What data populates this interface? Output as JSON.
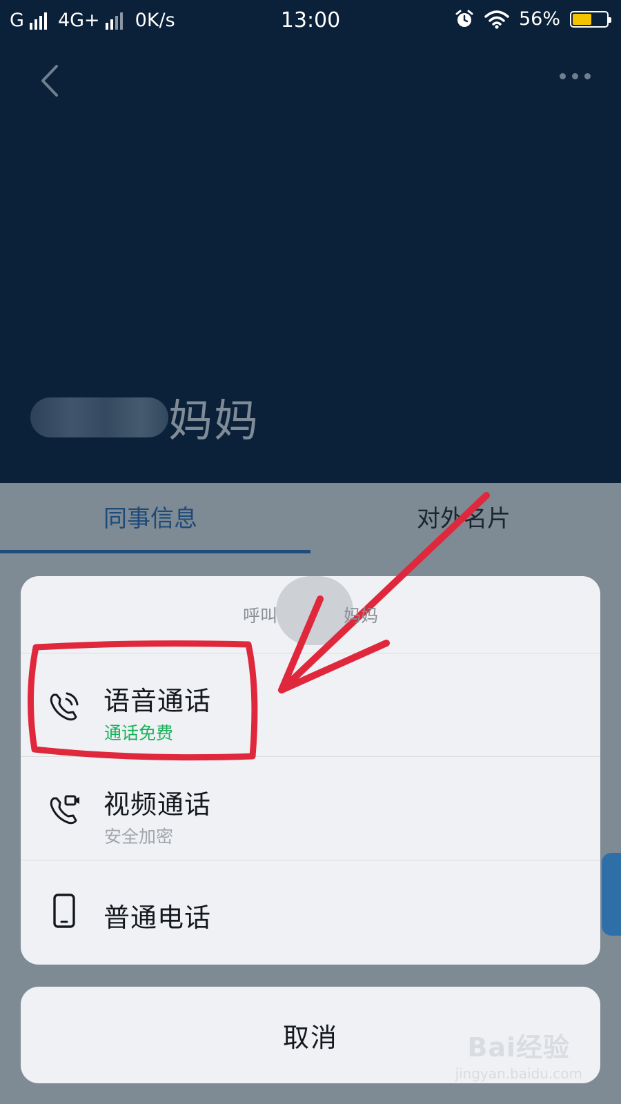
{
  "status_bar": {
    "carrier1": "G",
    "network2": "4G+",
    "speed": "0K/s",
    "time": "13:00",
    "battery_percent": "56%",
    "battery_level": 0.56,
    "icons": [
      "signal-icon",
      "alarm-icon",
      "wifi-icon",
      "battery-icon"
    ]
  },
  "nav": {
    "back_icon": "chevron-left-icon",
    "more_icon": "more-dots-icon"
  },
  "contact": {
    "name": "妈妈"
  },
  "tabs": [
    {
      "label": "同事信息",
      "active": true
    },
    {
      "label": "对外名片",
      "active": false
    }
  ],
  "call_sheet": {
    "title_prefix": "呼叫",
    "title_name": "妈妈",
    "options": [
      {
        "icon": "voice-call-icon",
        "label": "语音通话",
        "sublabel": "通话免费",
        "sub_color": "#19b25a"
      },
      {
        "icon": "video-call-icon",
        "label": "视频通话",
        "sublabel": "安全加密",
        "sub_color": "#a1a6ad"
      },
      {
        "icon": "phone-icon",
        "label": "普通电话"
      }
    ]
  },
  "cancel_label": "取消",
  "watermark": {
    "main": "Bai经验",
    "sub": "jingyan.baidu.com"
  },
  "colors": {
    "header_bg": "#0b2039",
    "accent": "#1f4d7a",
    "highlight_red": "#e0283c",
    "green": "#19b25a"
  }
}
